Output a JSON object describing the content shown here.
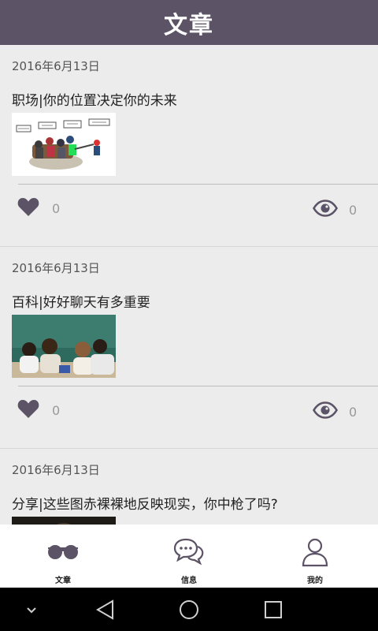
{
  "appbar": {
    "title": "文章"
  },
  "articles": [
    {
      "date": "2016年6月13日",
      "title": "职场|你的位置决定你的未来",
      "likes": "0",
      "views": "0",
      "image": "office-meeting-cartoon"
    },
    {
      "date": "2016年6月13日",
      "title": "百科|好好聊天有多重要",
      "likes": "0",
      "views": "0",
      "image": "classroom-chat-photo"
    },
    {
      "date": "2016年6月13日",
      "title": "分享|这些图赤裸裸地反映现实，你中枪了吗?",
      "image": "article-photo"
    }
  ],
  "tabbar": {
    "items": [
      {
        "label": "文章",
        "icon": "glasses-icon"
      },
      {
        "label": "信息",
        "icon": "chat-bubbles-icon"
      },
      {
        "label": "我的",
        "icon": "person-icon"
      }
    ]
  },
  "navbar": {
    "icons": [
      "chevron-down-icon",
      "back-icon",
      "home-icon",
      "recents-icon"
    ]
  },
  "colors": {
    "primary": "#5c5366",
    "background": "#ececec",
    "count": "#999999",
    "navbar": "#000000"
  }
}
